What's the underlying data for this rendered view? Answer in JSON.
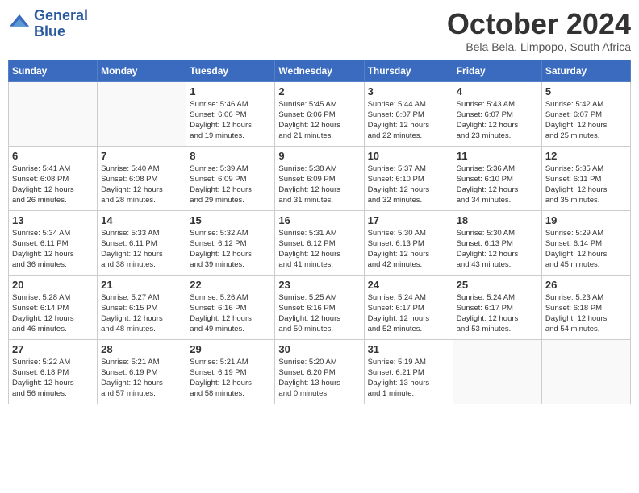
{
  "header": {
    "logo_line1": "General",
    "logo_line2": "Blue",
    "month_title": "October 2024",
    "location": "Bela Bela, Limpopo, South Africa"
  },
  "weekdays": [
    "Sunday",
    "Monday",
    "Tuesday",
    "Wednesday",
    "Thursday",
    "Friday",
    "Saturday"
  ],
  "weeks": [
    [
      {
        "day": "",
        "info": ""
      },
      {
        "day": "",
        "info": ""
      },
      {
        "day": "1",
        "info": "Sunrise: 5:46 AM\nSunset: 6:06 PM\nDaylight: 12 hours\nand 19 minutes."
      },
      {
        "day": "2",
        "info": "Sunrise: 5:45 AM\nSunset: 6:06 PM\nDaylight: 12 hours\nand 21 minutes."
      },
      {
        "day": "3",
        "info": "Sunrise: 5:44 AM\nSunset: 6:07 PM\nDaylight: 12 hours\nand 22 minutes."
      },
      {
        "day": "4",
        "info": "Sunrise: 5:43 AM\nSunset: 6:07 PM\nDaylight: 12 hours\nand 23 minutes."
      },
      {
        "day": "5",
        "info": "Sunrise: 5:42 AM\nSunset: 6:07 PM\nDaylight: 12 hours\nand 25 minutes."
      }
    ],
    [
      {
        "day": "6",
        "info": "Sunrise: 5:41 AM\nSunset: 6:08 PM\nDaylight: 12 hours\nand 26 minutes."
      },
      {
        "day": "7",
        "info": "Sunrise: 5:40 AM\nSunset: 6:08 PM\nDaylight: 12 hours\nand 28 minutes."
      },
      {
        "day": "8",
        "info": "Sunrise: 5:39 AM\nSunset: 6:09 PM\nDaylight: 12 hours\nand 29 minutes."
      },
      {
        "day": "9",
        "info": "Sunrise: 5:38 AM\nSunset: 6:09 PM\nDaylight: 12 hours\nand 31 minutes."
      },
      {
        "day": "10",
        "info": "Sunrise: 5:37 AM\nSunset: 6:10 PM\nDaylight: 12 hours\nand 32 minutes."
      },
      {
        "day": "11",
        "info": "Sunrise: 5:36 AM\nSunset: 6:10 PM\nDaylight: 12 hours\nand 34 minutes."
      },
      {
        "day": "12",
        "info": "Sunrise: 5:35 AM\nSunset: 6:11 PM\nDaylight: 12 hours\nand 35 minutes."
      }
    ],
    [
      {
        "day": "13",
        "info": "Sunrise: 5:34 AM\nSunset: 6:11 PM\nDaylight: 12 hours\nand 36 minutes."
      },
      {
        "day": "14",
        "info": "Sunrise: 5:33 AM\nSunset: 6:11 PM\nDaylight: 12 hours\nand 38 minutes."
      },
      {
        "day": "15",
        "info": "Sunrise: 5:32 AM\nSunset: 6:12 PM\nDaylight: 12 hours\nand 39 minutes."
      },
      {
        "day": "16",
        "info": "Sunrise: 5:31 AM\nSunset: 6:12 PM\nDaylight: 12 hours\nand 41 minutes."
      },
      {
        "day": "17",
        "info": "Sunrise: 5:30 AM\nSunset: 6:13 PM\nDaylight: 12 hours\nand 42 minutes."
      },
      {
        "day": "18",
        "info": "Sunrise: 5:30 AM\nSunset: 6:13 PM\nDaylight: 12 hours\nand 43 minutes."
      },
      {
        "day": "19",
        "info": "Sunrise: 5:29 AM\nSunset: 6:14 PM\nDaylight: 12 hours\nand 45 minutes."
      }
    ],
    [
      {
        "day": "20",
        "info": "Sunrise: 5:28 AM\nSunset: 6:14 PM\nDaylight: 12 hours\nand 46 minutes."
      },
      {
        "day": "21",
        "info": "Sunrise: 5:27 AM\nSunset: 6:15 PM\nDaylight: 12 hours\nand 48 minutes."
      },
      {
        "day": "22",
        "info": "Sunrise: 5:26 AM\nSunset: 6:16 PM\nDaylight: 12 hours\nand 49 minutes."
      },
      {
        "day": "23",
        "info": "Sunrise: 5:25 AM\nSunset: 6:16 PM\nDaylight: 12 hours\nand 50 minutes."
      },
      {
        "day": "24",
        "info": "Sunrise: 5:24 AM\nSunset: 6:17 PM\nDaylight: 12 hours\nand 52 minutes."
      },
      {
        "day": "25",
        "info": "Sunrise: 5:24 AM\nSunset: 6:17 PM\nDaylight: 12 hours\nand 53 minutes."
      },
      {
        "day": "26",
        "info": "Sunrise: 5:23 AM\nSunset: 6:18 PM\nDaylight: 12 hours\nand 54 minutes."
      }
    ],
    [
      {
        "day": "27",
        "info": "Sunrise: 5:22 AM\nSunset: 6:18 PM\nDaylight: 12 hours\nand 56 minutes."
      },
      {
        "day": "28",
        "info": "Sunrise: 5:21 AM\nSunset: 6:19 PM\nDaylight: 12 hours\nand 57 minutes."
      },
      {
        "day": "29",
        "info": "Sunrise: 5:21 AM\nSunset: 6:19 PM\nDaylight: 12 hours\nand 58 minutes."
      },
      {
        "day": "30",
        "info": "Sunrise: 5:20 AM\nSunset: 6:20 PM\nDaylight: 13 hours\nand 0 minutes."
      },
      {
        "day": "31",
        "info": "Sunrise: 5:19 AM\nSunset: 6:21 PM\nDaylight: 13 hours\nand 1 minute."
      },
      {
        "day": "",
        "info": ""
      },
      {
        "day": "",
        "info": ""
      }
    ]
  ]
}
